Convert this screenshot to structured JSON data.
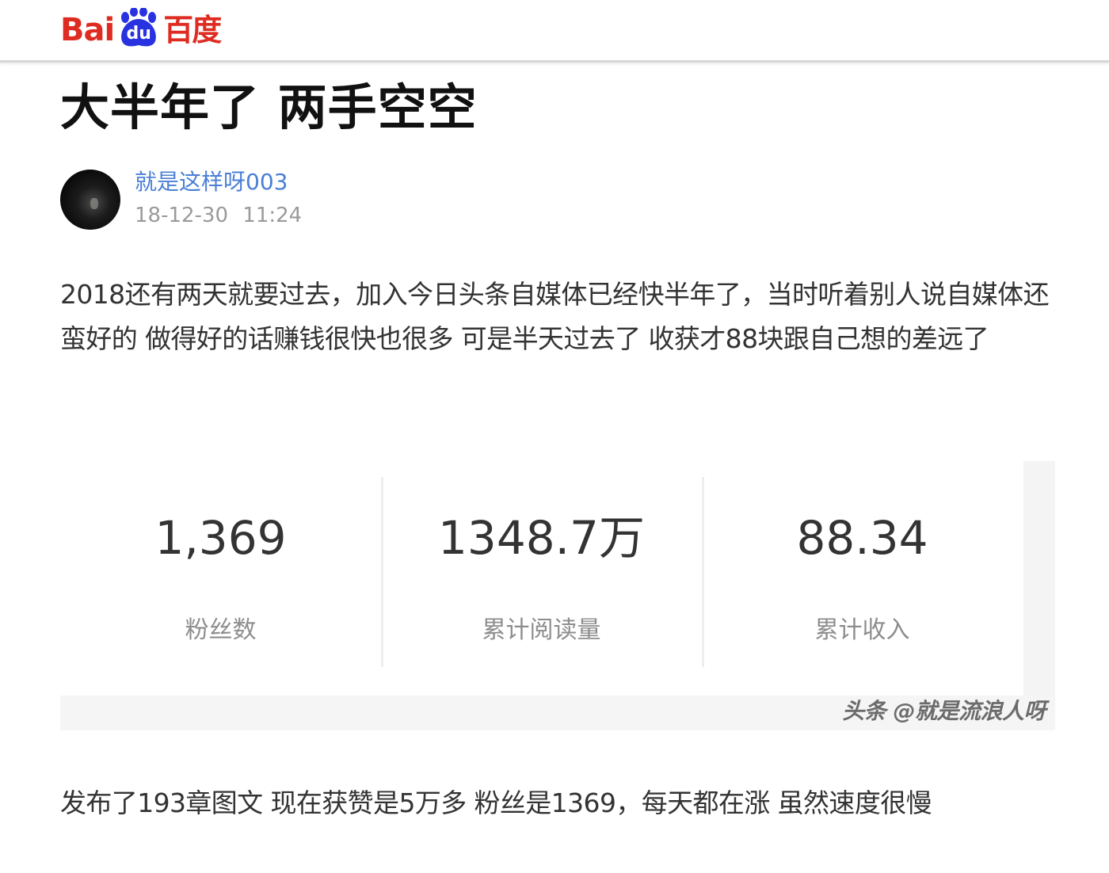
{
  "header": {
    "logo_text_latin": "Bai",
    "logo_text_du": "du",
    "logo_text_cn": "百度",
    "brand_color": "#de2c22",
    "logo_icon": "baidu-paw-icon"
  },
  "article": {
    "title": "大半年了 两手空空",
    "author": {
      "name": "就是这样呀003",
      "name_color": "#4a7fd6",
      "timestamp": "18-12-30  11:24"
    },
    "paragraph_1": "2018还有两天就要过去，加入今日头条自媒体已经快半年了，当时听着别人说自媒体还蛮好的 做得好的话赚钱很快也很多 可是半天过去了 收获才88块跟自己想的差远了",
    "stats_image": {
      "stats": [
        {
          "value": "1,369",
          "label": "粉丝数"
        },
        {
          "value": "1348.7万",
          "label": "累计阅读量"
        },
        {
          "value": "88.34",
          "label": "累计收入"
        }
      ],
      "watermark": "头条 @就是流浪人呀"
    },
    "paragraph_2": "发布了193章图文 现在获赞是5万多 粉丝是1369，每天都在涨 虽然速度很慢"
  }
}
